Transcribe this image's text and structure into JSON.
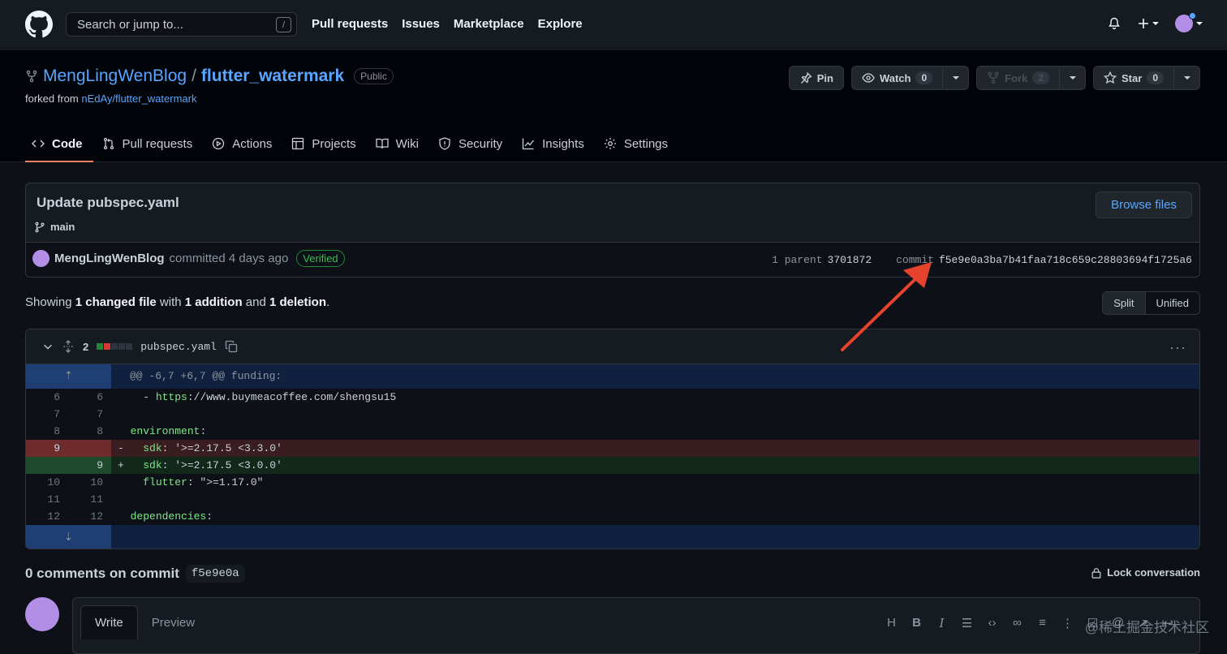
{
  "topbar": {
    "search_placeholder": "Search or jump to...",
    "search_shortcut": "/",
    "nav": [
      "Pull requests",
      "Issues",
      "Marketplace",
      "Explore"
    ]
  },
  "repo": {
    "owner": "MengLingWenBlog",
    "separator": "/",
    "name": "flutter_watermark",
    "visibility": "Public",
    "forked_prefix": "forked from",
    "forked_from": "nEdAy/flutter_watermark",
    "pin_label": "Pin",
    "watch_label": "Watch",
    "watch_count": "0",
    "fork_label": "Fork",
    "fork_count": "2",
    "star_label": "Star",
    "star_count": "0"
  },
  "tabs": [
    {
      "label": "Code",
      "icon": "code-icon"
    },
    {
      "label": "Pull requests",
      "icon": "pull-request-icon"
    },
    {
      "label": "Actions",
      "icon": "play-icon"
    },
    {
      "label": "Projects",
      "icon": "table-icon"
    },
    {
      "label": "Wiki",
      "icon": "book-icon"
    },
    {
      "label": "Security",
      "icon": "shield-icon"
    },
    {
      "label": "Insights",
      "icon": "graph-icon"
    },
    {
      "label": "Settings",
      "icon": "gear-icon"
    }
  ],
  "commit": {
    "title": "Update pubspec.yaml",
    "branch": "main",
    "browse_label": "Browse files",
    "author": "MengLingWenBlog",
    "action": "committed 4 days ago",
    "verified": "Verified",
    "parent_label": "1 parent",
    "parent_sha": "3701872",
    "commit_label": "commit",
    "sha": "f5e9e0a3ba7b41faa718c659c28803694f1725a6"
  },
  "summary": {
    "prefix": "Showing",
    "changed": "1 changed file",
    "with": "with",
    "additions": "1 addition",
    "and": "and",
    "deletions": "1 deletion",
    "suffix": ".",
    "split": "Split",
    "unified": "Unified"
  },
  "diff": {
    "change_count": "2",
    "filename": "pubspec.yaml",
    "hunk": "@@ -6,7 +6,7 @@ funding:",
    "lines": [
      {
        "old": "6",
        "new": "6",
        "type": "ctx",
        "text": "  - https://www.buymeacoffee.com/shengsu15"
      },
      {
        "old": "7",
        "new": "7",
        "type": "ctx",
        "text": ""
      },
      {
        "old": "8",
        "new": "8",
        "type": "ctx",
        "text": "environment:"
      },
      {
        "old": "9",
        "new": "",
        "type": "del",
        "sign": "-",
        "text": "  sdk: '>=2.17.5 <3.3.0'"
      },
      {
        "old": "",
        "new": "9",
        "type": "add",
        "sign": "+",
        "text": "  sdk: '>=2.17.5 <3.0.0'"
      },
      {
        "old": "10",
        "new": "10",
        "type": "ctx",
        "text": "  flutter: \">=1.17.0\""
      },
      {
        "old": "11",
        "new": "11",
        "type": "ctx",
        "text": ""
      },
      {
        "old": "12",
        "new": "12",
        "type": "ctx",
        "text": "dependencies:"
      }
    ]
  },
  "comments": {
    "title": "0 comments on commit",
    "sha_short": "f5e9e0a",
    "lock_label": "Lock conversation",
    "write_tab": "Write",
    "preview_tab": "Preview",
    "toolbar": [
      "H",
      "B",
      "I"
    ]
  },
  "watermark": "@稀土掘金技术社区",
  "colors": {
    "accent_blue": "#58a6ff",
    "tab_underline": "#f78166",
    "verified_green": "#3fb950",
    "annotation_arrow": "#e5432d"
  }
}
